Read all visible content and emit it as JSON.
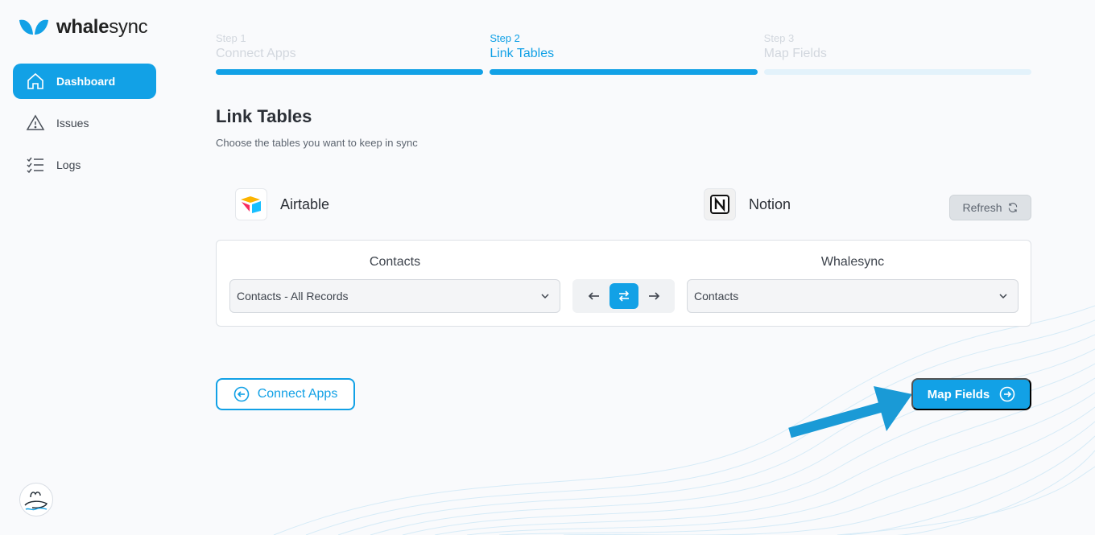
{
  "brand": {
    "name_bold": "whale",
    "name_thin": "sync"
  },
  "sidebar": {
    "items": [
      {
        "label": "Dashboard",
        "icon": "home-icon",
        "active": true
      },
      {
        "label": "Issues",
        "icon": "warning-icon",
        "active": false
      },
      {
        "label": "Logs",
        "icon": "checklist-icon",
        "active": false
      }
    ]
  },
  "steps": [
    {
      "num": "Step 1",
      "title": "Connect Apps",
      "state": "done"
    },
    {
      "num": "Step 2",
      "title": "Link Tables",
      "state": "active"
    },
    {
      "num": "Step 3",
      "title": "Map Fields",
      "state": "pending"
    }
  ],
  "main": {
    "title": "Link Tables",
    "subtitle": "Choose the tables you want to keep in sync"
  },
  "apps": {
    "left": {
      "name": "Airtable",
      "icon": "airtable-logo-icon"
    },
    "right": {
      "name": "Notion",
      "icon": "notion-logo-icon"
    }
  },
  "refresh": {
    "label": "Refresh"
  },
  "link": {
    "left_label": "Contacts",
    "right_label": "Whalesync",
    "left_value": "Contacts - All Records",
    "right_value": "Contacts",
    "direction": "two-way"
  },
  "actions": {
    "back_label": "Connect Apps",
    "next_label": "Map Fields"
  },
  "colors": {
    "accent": "#12a1e6",
    "pending_bar": "#e3f2fb",
    "arrow": "#1a9ad6"
  }
}
